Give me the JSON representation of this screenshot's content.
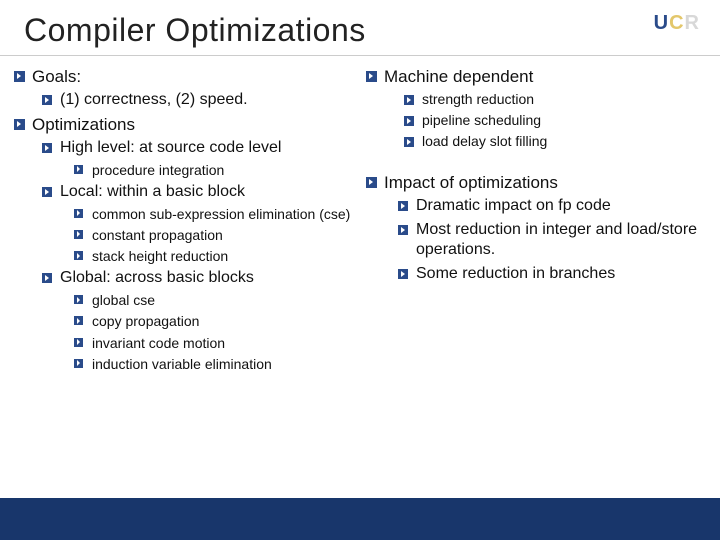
{
  "title": "Compiler Optimizations",
  "logo": {
    "u": "U",
    "c": "C",
    "r": "R"
  },
  "left": {
    "goals": {
      "label": "Goals:",
      "items": [
        "(1) correctness, (2) speed."
      ]
    },
    "optimizations": {
      "label": "Optimizations",
      "high": {
        "label": "High level: at source code level",
        "items": [
          "procedure integration"
        ]
      },
      "local": {
        "label": "Local: within a basic block",
        "items": [
          "common sub-expression elimination (cse)",
          "constant propagation",
          "stack height reduction"
        ]
      },
      "global": {
        "label": "Global: across basic blocks",
        "items": [
          "global cse",
          "copy propagation",
          "invariant code motion",
          "induction variable elimination"
        ]
      }
    }
  },
  "right": {
    "machine": {
      "label": "Machine dependent",
      "items": [
        "strength reduction",
        "pipeline scheduling",
        "load delay slot filling"
      ]
    },
    "impact": {
      "label": "Impact of optimizations",
      "items": [
        "Dramatic impact on fp code",
        "Most reduction in integer and load/store operations.",
        "Some reduction in branches"
      ]
    }
  }
}
